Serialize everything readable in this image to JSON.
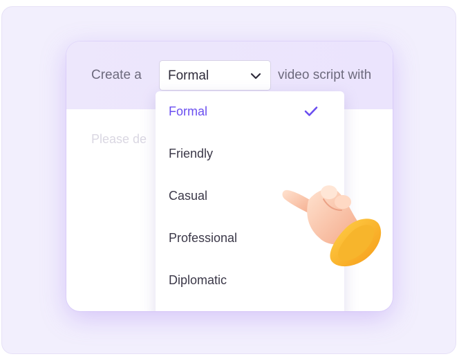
{
  "prompt": {
    "prefix": "Create a",
    "suffix": "video script with",
    "placeholder": "Please de"
  },
  "tone_select": {
    "selected": "Formal",
    "options": [
      "Formal",
      "Friendly",
      "Casual",
      "Professional",
      "Diplomatic"
    ]
  },
  "icons": {
    "chevron": "chevron-down-icon",
    "check": "check-icon",
    "hand": "pointing-hand-icon"
  },
  "colors": {
    "accent": "#6a4ef0",
    "header_bg": "#ede7fc",
    "outer_bg": "#f2effd"
  }
}
